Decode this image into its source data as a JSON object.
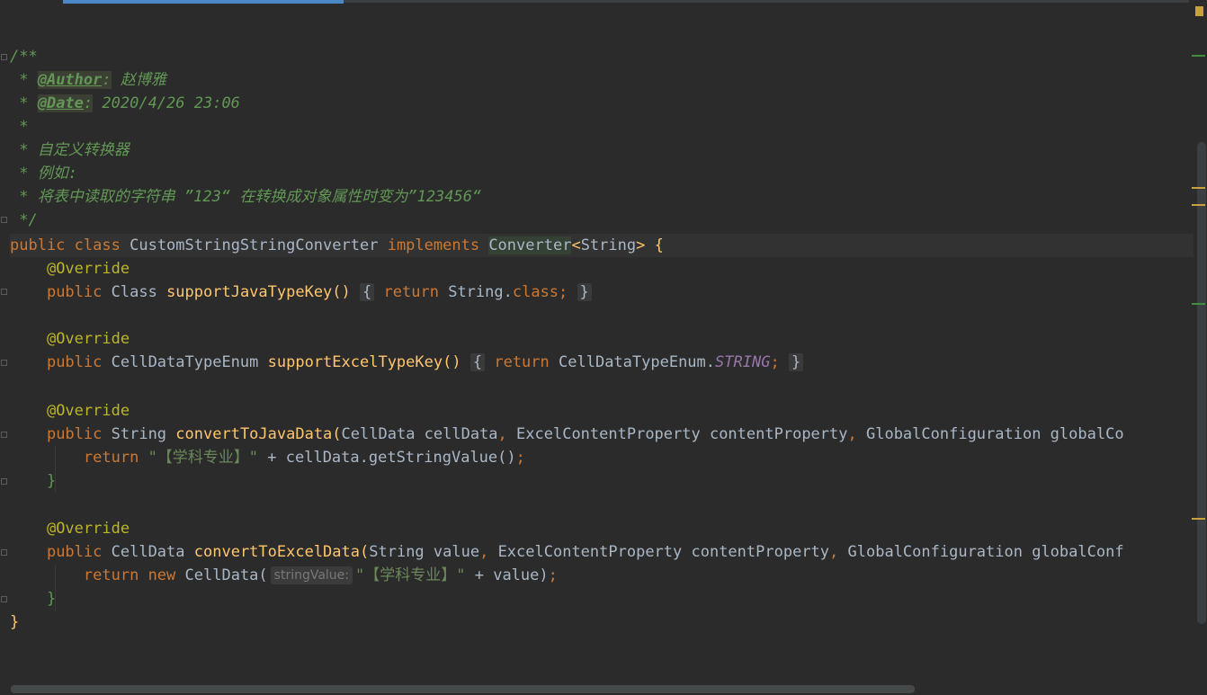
{
  "editor": {
    "doc": {
      "open": "/**",
      "author_star": " * ",
      "author_tag": "@Author",
      "author_colon": ":",
      "author_value": " 赵博雅",
      "date_star": " * ",
      "date_tag": "@Date",
      "date_colon": ":",
      "date_value": " 2020/4/26 23:06",
      "blank": " *",
      "line_desc": " * 自定义转换器",
      "line_example": " * 例如:",
      "line_detail": " * 将表中读取的字符串 ”123“ 在转换成对象属性时变为”123456“",
      "close": " */"
    },
    "class_decl": {
      "kw_public": "public",
      "kw_class": "class",
      "name": "CustomStringStringConverter",
      "kw_implements": "implements",
      "iface": "Converter",
      "generic_open": "<",
      "generic_type": "String",
      "generic_close": ">",
      "brace": "{"
    },
    "method1": {
      "annotation": "@Override",
      "kw_public": "public",
      "ret_type": "Class",
      "name": "supportJavaTypeKey",
      "parens": "()",
      "fold_open": "{",
      "kw_return": "return",
      "expr_a": "String.",
      "expr_b": "class",
      "semi": ";",
      "fold_close": "}"
    },
    "method2": {
      "annotation": "@Override",
      "kw_public": "public",
      "ret_type": "CellDataTypeEnum",
      "name": "supportExcelTypeKey",
      "parens": "()",
      "fold_open": "{",
      "kw_return": "return",
      "expr_a": "CellDataTypeEnum.",
      "expr_b": "STRING",
      "semi": ";",
      "fold_close": "}"
    },
    "method3": {
      "annotation": "@Override",
      "kw_public": "public",
      "ret_type": "String",
      "name": "convertToJavaData",
      "paren_open": "(",
      "p1": "CellData cellData",
      "comma1": ",",
      "p2": " ExcelContentProperty contentProperty",
      "comma2": ",",
      "p3": " GlobalConfiguration globalCo",
      "kw_return": "return",
      "string": "\"【学科专业】\"",
      "rest": " + cellData.getStringValue()",
      "semi": ";",
      "close_brace": "}"
    },
    "method4": {
      "annotation": "@Override",
      "kw_public": "public",
      "ret_type": "CellData",
      "name": "convertToExcelData",
      "paren_open": "(",
      "p1": "String value",
      "comma1": ",",
      "p2": " ExcelContentProperty contentProperty",
      "comma2": ",",
      "p3": " GlobalConfiguration globalConf",
      "kw_return": "return",
      "kw_new": "new",
      "ctor": "CellData(",
      "hint": "stringValue:",
      "string": "\"【学科专业】\"",
      "rest": " + value)",
      "semi": ";",
      "close_brace": "}"
    },
    "class_close": "}"
  }
}
